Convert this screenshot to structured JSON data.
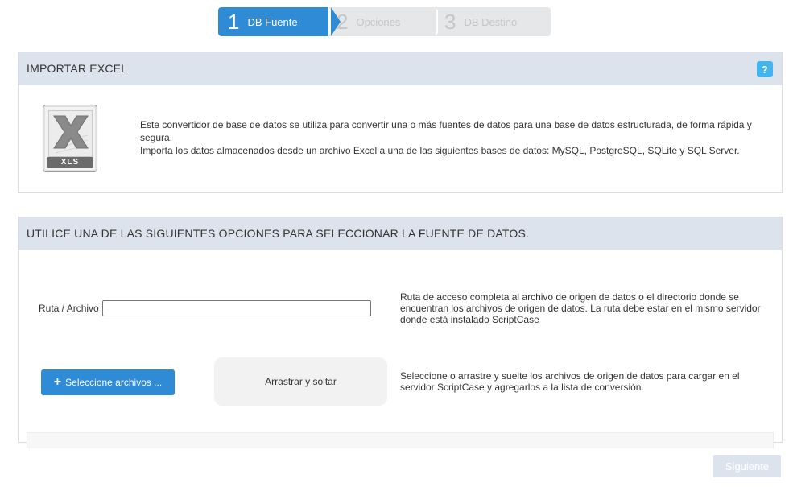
{
  "wizard": {
    "steps": [
      {
        "number": "1",
        "label": "DB Fuente",
        "state": "active"
      },
      {
        "number": "2",
        "label": "Opciones",
        "state": "inactive"
      },
      {
        "number": "3",
        "label": "DB Destino",
        "state": "inactive"
      }
    ]
  },
  "import_panel": {
    "title": "IMPORTAR EXCEL",
    "help_label": "?",
    "icon": {
      "name": "xls-file-icon",
      "label": "XLS"
    },
    "description_line1": "Este convertidor de base de datos se utiliza para convertir una o más fuentes de datos para una base de datos estructurada, de forma rápida y segura.",
    "description_line2": "Importa los datos almacenados desde un archivo Excel a una de las siguientes bases de datos: MySQL, PostgreSQL, SQLite y SQL Server."
  },
  "source_panel": {
    "title": "UTILICE UNA DE LAS SIGUIENTES OPCIONES PARA SELECCIONAR LA FUENTE DE DATOS.",
    "path_label": "Ruta / Archivo",
    "path_value": "",
    "path_hint": "Ruta de acceso completa al archivo de origen de datos o el directorio donde se encuentran los archivos de origen de datos. La ruta debe estar en el mismo servidor donde está instalado ScriptCase",
    "select_button_icon": "+",
    "select_button_label": "Seleccione archivos ...",
    "dropzone_label": "Arrastrar y soltar",
    "upload_hint": "Seleccione o arrastre y suelte los archivos de origen de datos para cargar en el servidor ScriptCase y agregarlos a la lista de conversión."
  },
  "footer": {
    "next_label": "Siguiente"
  },
  "colors": {
    "accent": "#2f8bd6",
    "panel_header": "#dde3ec",
    "help": "#42b4ef",
    "step_inactive": "#e6e7e8"
  }
}
